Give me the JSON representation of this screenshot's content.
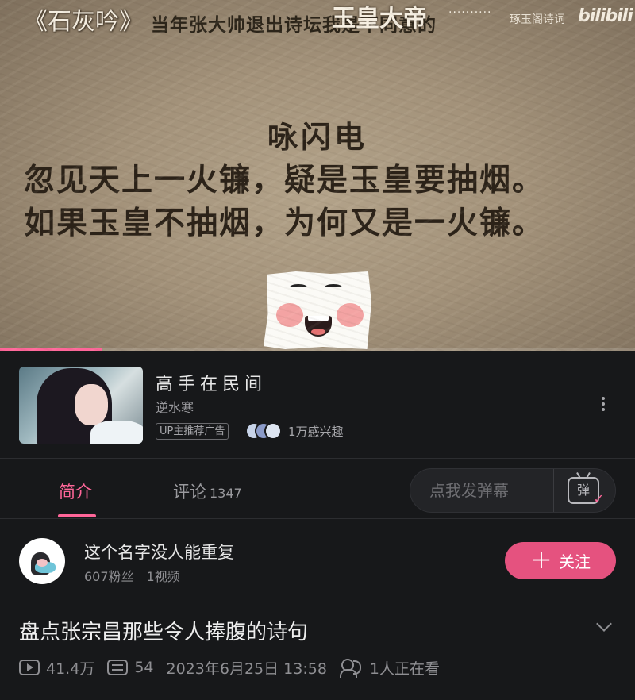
{
  "player": {
    "top_left_title": "《石灰吟》",
    "top_subtitle": "当年张大帅退出诗坛我是不同意的",
    "overlay_name": "玉皇大帝",
    "overlay_dots": "··········",
    "watermark": "琢玉阁诗词",
    "logo": "bilibili",
    "poem_title": "咏闪电",
    "poem_line_1": "忽见天上一火镰，疑是玉皇要抽烟。",
    "poem_line_2": "如果玉皇不抽烟，为何又是一火镰。",
    "progress": 0.16,
    "accent_color": "#ff6699"
  },
  "ad": {
    "title": "高手在民间",
    "subtitle": "逆水寒",
    "badge": "UP主推荐广告",
    "interest": "1万感兴趣",
    "more_icon": "more-vertical-icon"
  },
  "tabs": {
    "intro_label": "简介",
    "comments_label": "评论",
    "comments_count": "1347",
    "danmaku_placeholder": "点我发弹幕",
    "danmaku_button": "弹"
  },
  "uploader": {
    "name": "这个名字没人能重复",
    "followers": "607粉丝",
    "videos": "1视频",
    "follow_icon": "＋",
    "follow_label": "关注",
    "follow_color": "#e5527f"
  },
  "video": {
    "title": "盘点张宗昌那些令人捧腹的诗句",
    "views": "41.4万",
    "danmaku_count": "54",
    "date": "2023年6月25日 13:58",
    "watching": "1人正在看"
  }
}
